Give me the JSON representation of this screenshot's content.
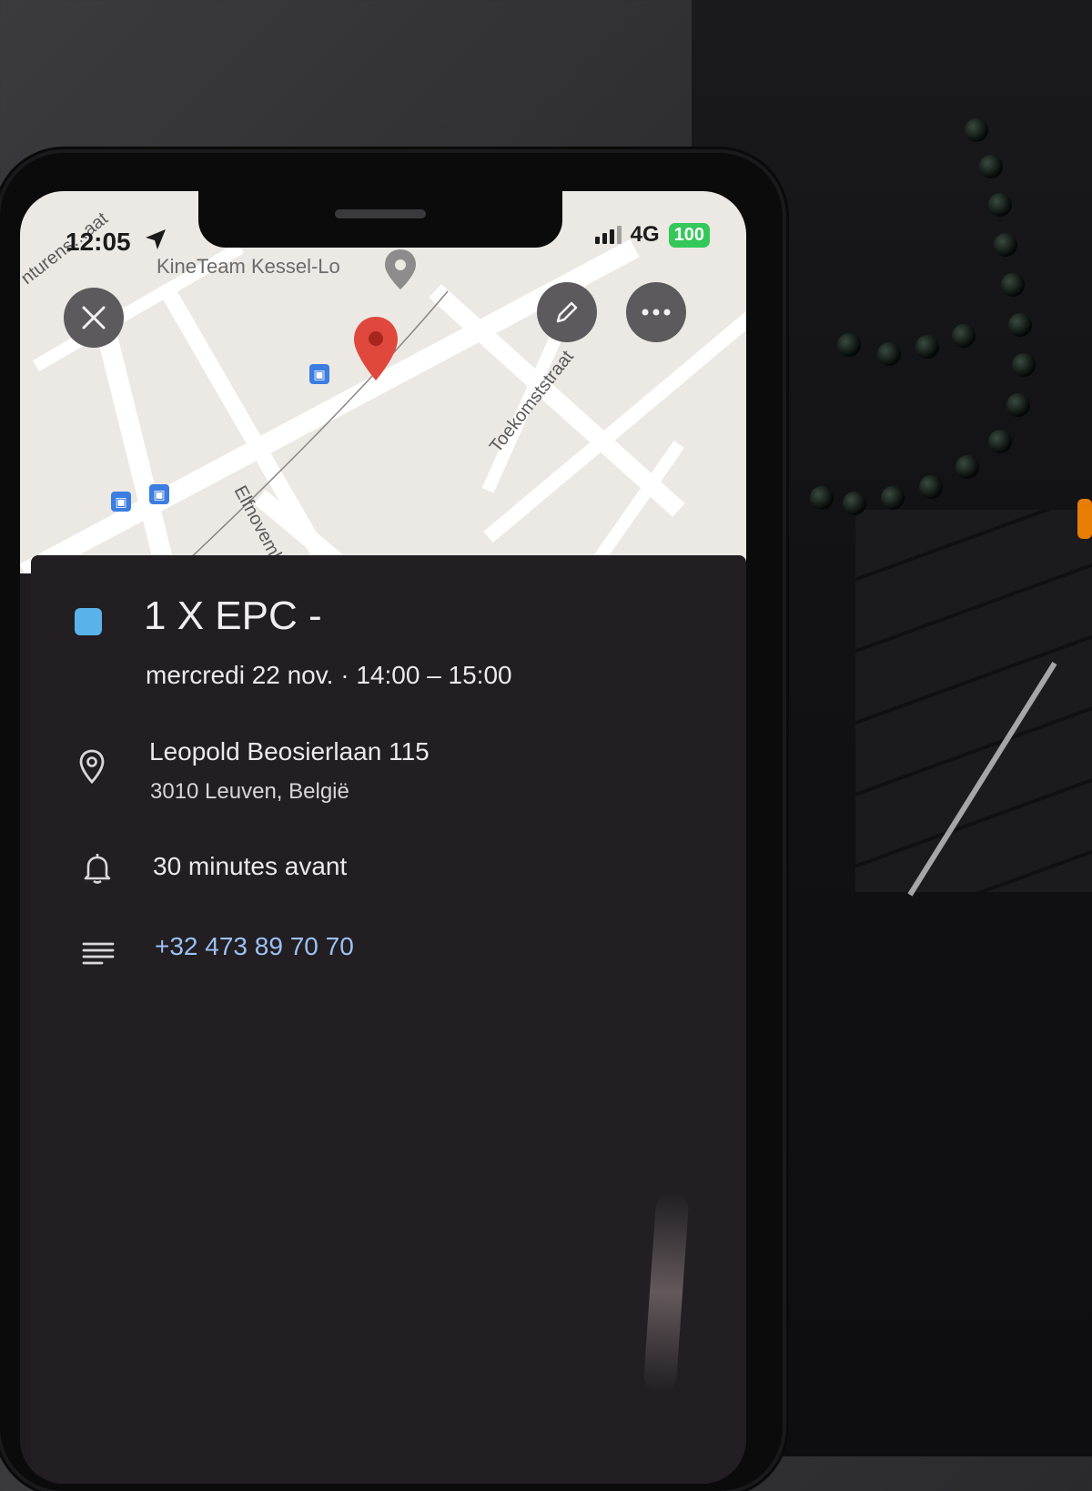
{
  "status_bar": {
    "time": "12:05",
    "network": "4G",
    "battery": "100"
  },
  "map": {
    "poi": "KineTeam Kessel-Lo",
    "streets": [
      "Elfnovemberlaa",
      "Toekomststraat",
      "nturens…aat"
    ]
  },
  "event": {
    "title": "1 X EPC -",
    "color": "#5ab2ea",
    "datetime": "mercredi 22 nov. · 14:00 – 15:00",
    "location_line1": "Leopold Beosierlaan 115",
    "location_line2": "3010 Leuven, België",
    "reminder": "30 minutes avant",
    "description": "+32 473 89 70 70"
  },
  "icons": {
    "close": "close-icon",
    "edit": "pencil-icon",
    "more": "more-horizontal-icon",
    "location": "location-pin-icon",
    "reminder": "bell-icon",
    "description": "notes-icon",
    "map_pin": "map-pin-icon"
  }
}
